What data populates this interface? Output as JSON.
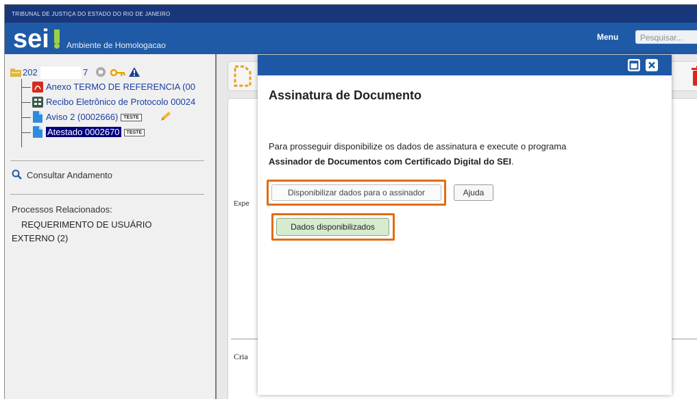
{
  "header": {
    "tribunal": "TRIBUNAL DE JUSTIÇA DO ESTADO DO RIO DE JANEIRO",
    "logo_text": "sei",
    "environment": "Ambiente de Homologacao",
    "menu_label": "Menu",
    "search_placeholder": "Pesquisar..."
  },
  "tree": {
    "process_number_prefix": "202",
    "process_number_suffix": "7",
    "documents": [
      {
        "label": "Anexo TERMO DE REFERENCIA (00",
        "icon": "pdf-icon"
      },
      {
        "label": "Recibo Eletrônico de Protocolo 00024",
        "icon": "receipt-icon"
      },
      {
        "label": "Aviso 2 (0002666)",
        "badge": "TESTE",
        "icon": "document-icon"
      },
      {
        "label": "Atestado 0002670",
        "badge": "TESTE",
        "icon": "document-icon"
      }
    ]
  },
  "sidebar": {
    "consult_label": "Consultar Andamento",
    "related_title": "Processos Relacionados:",
    "related_item": "REQUERIMENTO DE USUÁRIO EXTERNO (2)"
  },
  "document": {
    "expe_fragment": "Expe",
    "cria_fragment": "Cria"
  },
  "modal": {
    "title": "Assinatura de Documento",
    "text_prefix": "Para prosseguir disponibilize os dados de assinatura e execute o programa",
    "text_bold": "Assinador de Documentos com Certificado Digital do SEI",
    "text_suffix": ".",
    "provide_data_button": "Disponibilizar dados para o assinador",
    "help_button": "Ajuda",
    "data_provided_button": "Dados disponibilizados"
  },
  "colors": {
    "header_blue": "#1f5aa6",
    "top_bar": "#17377a",
    "highlight_orange": "#e06c10",
    "link_blue": "#1a3ea0"
  }
}
